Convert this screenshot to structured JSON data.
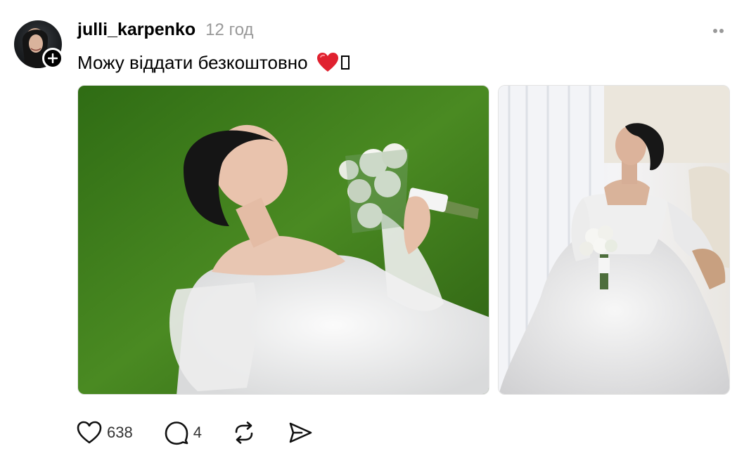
{
  "post": {
    "author": {
      "username": "julli_karpenko",
      "avatar_icon": "avatar",
      "follow_icon": "plus-icon"
    },
    "timestamp": "12 год",
    "caption": {
      "text": "Можу віддати безкоштовно",
      "emoji_icon": "red-heart-icon",
      "unrendered_glyph": "missing-glyph-box"
    },
    "images": [
      {
        "alt_icon": "photo-bride-lying-on-grass"
      },
      {
        "alt_icon": "photo-bride-sitting-by-window"
      }
    ],
    "actions": {
      "like_icon": "heart-outline-icon",
      "like_count": "638",
      "comment_icon": "comment-bubble-icon",
      "comment_count": "4",
      "repost_icon": "repost-icon",
      "share_icon": "send-icon"
    },
    "more_icon": "more-dots-icon"
  },
  "colors": {
    "text": "#000000",
    "muted": "#999999",
    "heart": "#e0212f",
    "grass": "#3e7d1c"
  }
}
